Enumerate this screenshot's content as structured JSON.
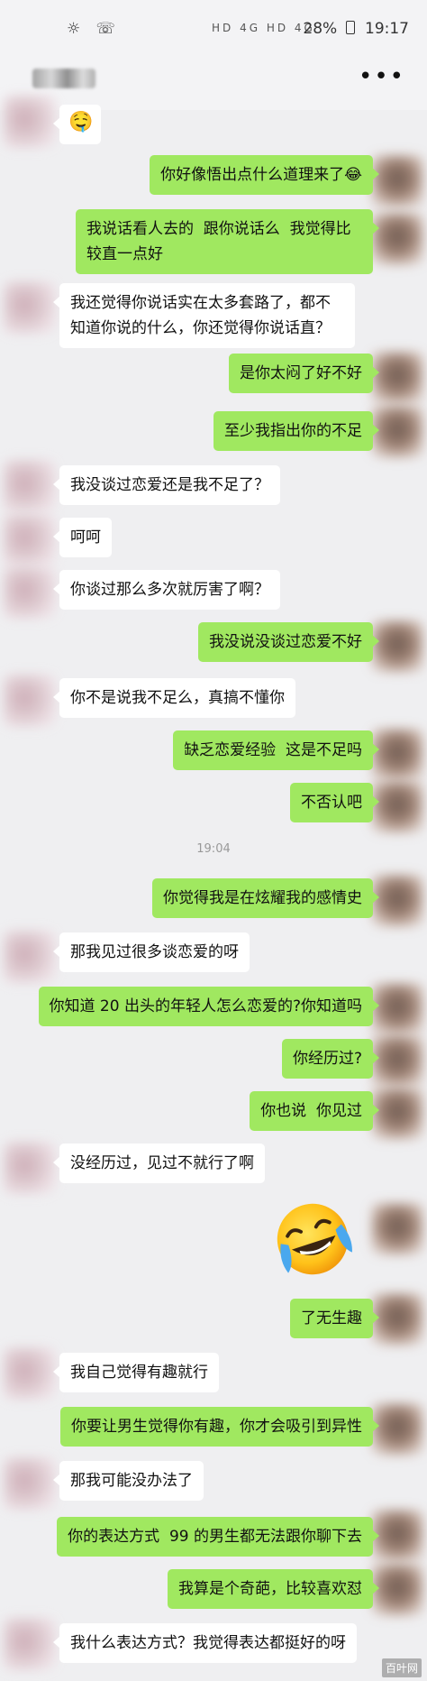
{
  "status_bar": {
    "left_icons": "☼ ☏",
    "network_icons": "HD 4G HD 4G",
    "battery": "28%",
    "time": "19:17"
  },
  "title_bar": {
    "more_icon": "•••"
  },
  "messages": [
    {
      "side": "left",
      "type": "emoji",
      "text": "🤤"
    },
    {
      "side": "right",
      "text": "你好像悟出点什么道理来了😂"
    },
    {
      "side": "right",
      "text": "我说话看人去的  跟你说话么  我觉得比较直一点好"
    },
    {
      "side": "left",
      "text": "我还觉得你说话实在太多套路了，都不知道你说的什么，你还觉得你说话直？"
    },
    {
      "side": "right",
      "text": "是你太闷了好不好"
    },
    {
      "side": "right",
      "text": "至少我指出你的不足"
    },
    {
      "side": "left",
      "text": "我没谈过恋爱还是我不足了？"
    },
    {
      "side": "left",
      "text": "呵呵"
    },
    {
      "side": "left",
      "text": "你谈过那么多次就厉害了啊？"
    },
    {
      "side": "right",
      "text": "我没说没谈过恋爱不好"
    },
    {
      "side": "left",
      "text": "你不是说我不足么，真搞不懂你"
    },
    {
      "side": "right",
      "text": "缺乏恋爱经验  这是不足吗"
    },
    {
      "side": "right",
      "text": "不否认吧"
    },
    {
      "type": "time",
      "text": "19:04"
    },
    {
      "side": "right",
      "text": "你觉得我是在炫耀我的感情史"
    },
    {
      "side": "left",
      "text": "那我见过很多谈恋爱的呀"
    },
    {
      "side": "right",
      "text": "你知道 20 出头的年轻人怎么恋爱的?你知道吗"
    },
    {
      "side": "right",
      "text": "你经历过?"
    },
    {
      "side": "right",
      "text": "你也说  你见过"
    },
    {
      "side": "left",
      "text": "没经历过，见过不就行了啊"
    },
    {
      "side": "right",
      "type": "sticker",
      "text": "crying-laughing-emoji"
    },
    {
      "side": "right",
      "text": "了无生趣"
    },
    {
      "side": "left",
      "text": "我自己觉得有趣就行"
    },
    {
      "side": "right",
      "text": "你要让男生觉得你有趣，你才会吸引到异性"
    },
    {
      "side": "left",
      "text": "那我可能没办法了"
    },
    {
      "side": "right",
      "text": "你的表达方式  99 的男生都无法跟你聊下去"
    },
    {
      "side": "right",
      "text": "我算是个奇葩，比较喜欢怼"
    },
    {
      "side": "left",
      "text": "我什么表达方式？我觉得表达都挺好的呀"
    }
  ],
  "watermark": "百叶网",
  "colors": {
    "background": "#efeff1",
    "bubble_right": "#a0e860",
    "bubble_left": "#ffffff"
  }
}
